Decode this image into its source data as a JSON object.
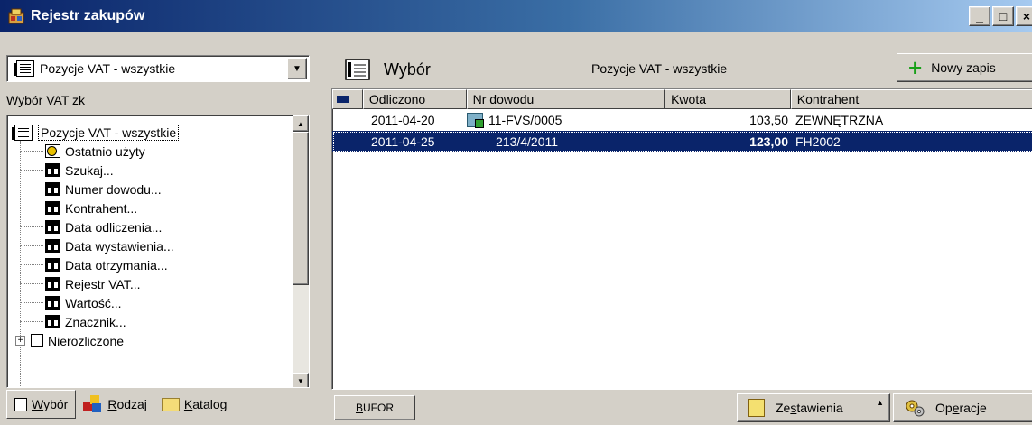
{
  "window": {
    "title": "Rejestr zakupów"
  },
  "left": {
    "combo_value": "Pozycje VAT - wszystkie",
    "section_label": "Wybór VAT zk",
    "tree_root": "Pozycje VAT - wszystkie",
    "tree_items": [
      {
        "label": "Ostatnio użyty",
        "icon": "recent-icon"
      },
      {
        "label": "Szukaj...",
        "icon": "binoculars-icon"
      },
      {
        "label": "Numer dowodu...",
        "icon": "binoculars-icon"
      },
      {
        "label": "Kontrahent...",
        "icon": "binoculars-icon"
      },
      {
        "label": "Data odliczenia...",
        "icon": "binoculars-icon"
      },
      {
        "label": "Data wystawienia...",
        "icon": "binoculars-icon"
      },
      {
        "label": "Data otrzymania...",
        "icon": "binoculars-icon"
      },
      {
        "label": "Rejestr VAT...",
        "icon": "binoculars-icon"
      },
      {
        "label": "Wartość...",
        "icon": "binoculars-icon"
      },
      {
        "label": "Znacznik...",
        "icon": "binoculars-icon"
      }
    ],
    "tree_partial_item": "Nierozliczone",
    "tabs": {
      "wybor_prefix": "",
      "wybor_u": "W",
      "wybor_rest": "ybór",
      "rodzaj_prefix": "",
      "rodzaj_u": "R",
      "rodzaj_rest": "odzaj",
      "katalog_prefix": "",
      "katalog_u": "K",
      "katalog_rest": "atalog"
    }
  },
  "right": {
    "panel_title": "Wybór",
    "center_title": "Pozycje VAT - wszystkie",
    "new_button": "Nowy zapis",
    "columns": [
      "Odliczono",
      "Nr dowodu",
      "Kwota",
      "Kontrahent"
    ],
    "rows": [
      {
        "date": "2011-04-20",
        "doc": "11-FVS/0005",
        "amount": "103,50",
        "contractor": "ZEWNĘTRZNA",
        "has_icon": true
      },
      {
        "date": "2011-04-25",
        "doc": "213/4/2011",
        "amount": "123,00",
        "contractor": "FH2002",
        "has_icon": false
      }
    ],
    "bufor_prefix": "",
    "bufor_u": "B",
    "bufor_rest": "UFOR",
    "zest_prefix": "Ze",
    "zest_u": "s",
    "zest_rest": "tawienia",
    "oper_prefix": "Op",
    "oper_u": "e",
    "oper_rest": "racje"
  }
}
